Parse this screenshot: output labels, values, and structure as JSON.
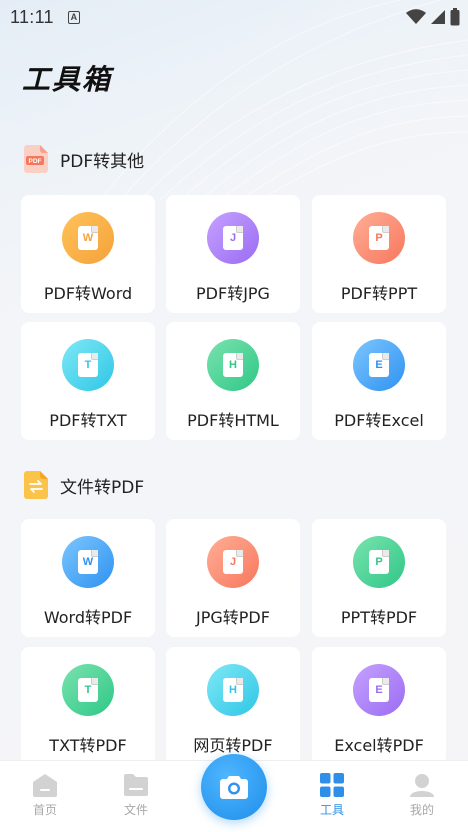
{
  "status": {
    "time": "11:11",
    "notif": "A"
  },
  "page_title": "工具箱",
  "sections": [
    {
      "title": "PDF转其他",
      "tools": [
        {
          "label": "PDF转Word",
          "letter": "W",
          "color_from": "#ffc25a",
          "color_to": "#f5a23a",
          "letter_color": "#f5a23a"
        },
        {
          "label": "PDF转JPG",
          "letter": "J",
          "color_from": "#c6a1ff",
          "color_to": "#9a6cf2",
          "letter_color": "#9a6cf2"
        },
        {
          "label": "PDF转PPT",
          "letter": "P",
          "color_from": "#ffae96",
          "color_to": "#f7775d",
          "letter_color": "#f7775d"
        },
        {
          "label": "PDF转TXT",
          "letter": "T",
          "color_from": "#7fe8f6",
          "color_to": "#2fc6e6",
          "letter_color": "#2fc6e6"
        },
        {
          "label": "PDF转HTML",
          "letter": "H",
          "color_from": "#79e3ae",
          "color_to": "#30c787",
          "letter_color": "#30c787"
        },
        {
          "label": "PDF转Excel",
          "letter": "E",
          "color_from": "#7cc6ff",
          "color_to": "#2f92f0",
          "letter_color": "#2f92f0"
        }
      ]
    },
    {
      "title": "文件转PDF",
      "tools": [
        {
          "label": "Word转PDF",
          "letter": "W",
          "color_from": "#7cc6ff",
          "color_to": "#2f92f0",
          "letter_color": "#2f92f0"
        },
        {
          "label": "JPG转PDF",
          "letter": "J",
          "color_from": "#ffae96",
          "color_to": "#f7775d",
          "letter_color": "#f7775d"
        },
        {
          "label": "PPT转PDF",
          "letter": "P",
          "color_from": "#79e3ae",
          "color_to": "#30c787",
          "letter_color": "#30c787"
        },
        {
          "label": "TXT转PDF",
          "letter": "T",
          "color_from": "#79e3ae",
          "color_to": "#30c787",
          "letter_color": "#30c787"
        },
        {
          "label": "网页转PDF",
          "letter": "H",
          "color_from": "#7fe8f6",
          "color_to": "#2fc6e6",
          "letter_color": "#2fc6e6"
        },
        {
          "label": "Excel转PDF",
          "letter": "E",
          "color_from": "#c6a1ff",
          "color_to": "#9a6cf2",
          "letter_color": "#9a6cf2"
        }
      ]
    }
  ],
  "tabbar": {
    "home": "首页",
    "files": "文件",
    "tools": "工具",
    "mine": "我的",
    "active_color": "#2f8fe8",
    "inactive_color": "#a8a8a8"
  }
}
